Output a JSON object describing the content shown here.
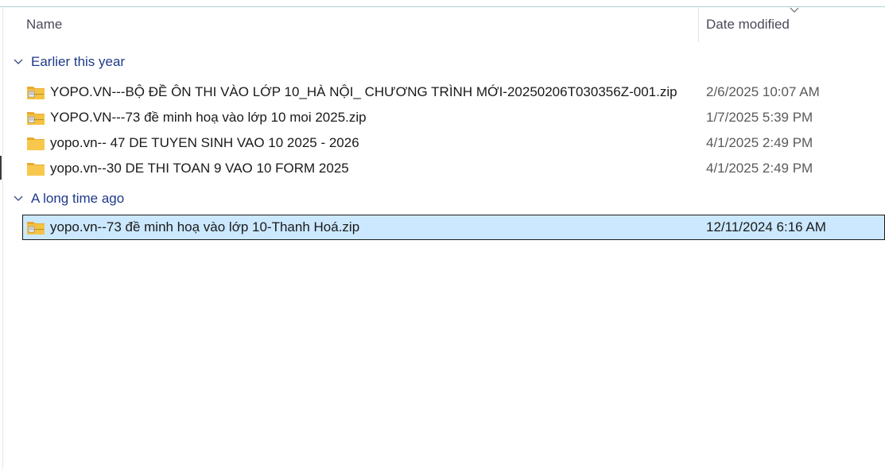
{
  "header": {
    "name_label": "Name",
    "date_label": "Date modified"
  },
  "groups": [
    {
      "label": "Earlier this year",
      "items": [
        {
          "name": "YOPO.VN---BỘ ĐỀ ÔN THI VÀO LỚP 10_HÀ NỘI_ CHƯƠNG TRÌNH MỚI-20250206T030356Z-001.zip",
          "date": "2/6/2025 10:07 AM",
          "icon": "zip-folder-icon"
        },
        {
          "name": "YOPO.VN---73 đề minh hoạ vào lớp 10 moi 2025.zip",
          "date": "1/7/2025 5:39 PM",
          "icon": "zip-folder-icon"
        },
        {
          "name": "yopo.vn-- 47 DE TUYEN SINH VAO 10 2025 - 2026",
          "date": "4/1/2025 2:49 PM",
          "icon": "folder-icon"
        },
        {
          "name": "yopo.vn--30 DE THI TOAN 9 VAO 10 FORM 2025",
          "date": "4/1/2025 2:49 PM",
          "icon": "folder-icon"
        }
      ]
    },
    {
      "label": "A long time ago",
      "items": [
        {
          "name": "yopo.vn--73 đề minh hoạ vào lớp 10-Thanh Hoá.zip",
          "date": "12/11/2024 6:16 AM",
          "icon": "zip-folder-icon",
          "selected": true
        }
      ]
    }
  ],
  "colors": {
    "group_label": "#1f3a8a",
    "selection": "#cce8ff",
    "folder": "#f5c242"
  }
}
